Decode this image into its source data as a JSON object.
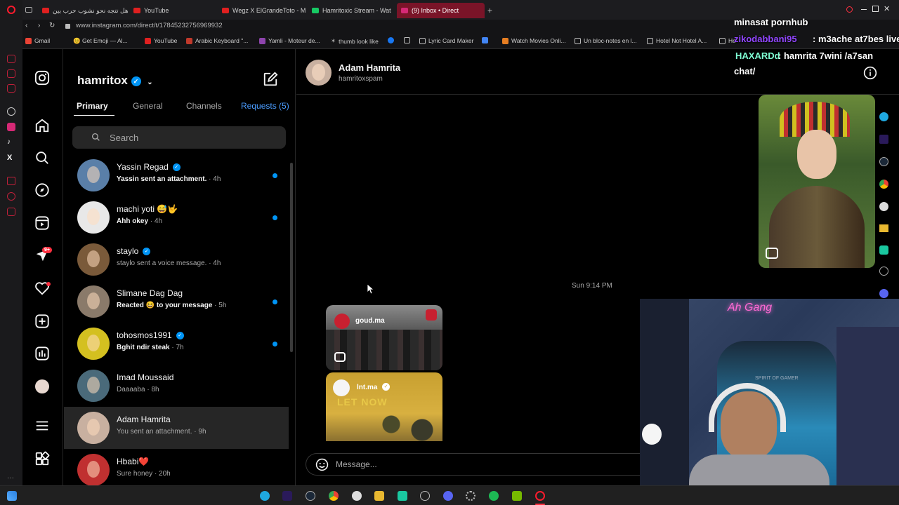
{
  "browser": {
    "tabs": [
      {
        "label": "هل تتجه نحو نشوب حرب بين",
        "color": "#e02020"
      },
      {
        "label": "YouTube",
        "color": "#e02020"
      },
      {
        "label": "Wegz X ElGrandeToto - M",
        "color": "#e02020"
      },
      {
        "label": "Hamritoxic Stream - Wat",
        "color": "#6441a5"
      },
      {
        "label": "(9) Inbox • Direct",
        "color": "#d62976",
        "active": true
      }
    ],
    "url": "www.instagram.com/direct/t/17845232756969932",
    "bookmarks": [
      "Gmail",
      "😊 Get Emoji — Al...",
      "YouTube",
      "Arabic Keyboard \"...",
      "Yamli - Moteur de...",
      "thumb look like",
      "",
      "Lyric Card Maker",
      "",
      "Watch Movies Onli...",
      "Un bloc-notes en l...",
      "Hotel Not Hotel A...",
      "Ho"
    ]
  },
  "nav": {
    "notifications_badge": "9+"
  },
  "inbox": {
    "username": "hamritox",
    "tabs": [
      {
        "label": "Primary",
        "active": true
      },
      {
        "label": "General"
      },
      {
        "label": "Channels"
      },
      {
        "label": "Requests (5)",
        "link": true
      }
    ],
    "search_placeholder": "Search",
    "threads": [
      {
        "name": "Yassin Regad",
        "verified": true,
        "message": "Yassin sent an attachment.",
        "time": "· 4h",
        "unread": true,
        "avatar": "#5a7fa8"
      },
      {
        "name": "machi yoti 😅🤟",
        "message": "Ahh okey",
        "time": "· 4h",
        "unread": true,
        "avatar": "#e8e8e8"
      },
      {
        "name": "staylo",
        "verified": true,
        "message": "staylo sent a voice message.",
        "time": "· 4h",
        "unread": false,
        "avatar": "#7a5a3a"
      },
      {
        "name": "Slimane Dag Dag",
        "message": "Reacted 😆 to your message",
        "time": "· 5h",
        "unread": true,
        "avatar": "#8a7a6a"
      },
      {
        "name": "tohosmos1991",
        "verified": true,
        "message": "Bghit ndir steak",
        "time": "· 7h",
        "unread": true,
        "avatar": "#d4c020"
      },
      {
        "name": "Imad Moussaid",
        "message": "Daaaaba",
        "time": "· 8h",
        "unread": false,
        "avatar": "#4a6a7a"
      },
      {
        "name": "Adam Hamrita",
        "message": "You sent an attachment.",
        "time": "· 9h",
        "unread": false,
        "selected": true,
        "avatar": "#c8b0a0"
      },
      {
        "name": "Hbabi❤️",
        "message": "Sure honey",
        "time": "· 20h",
        "unread": false,
        "avatar": "#c03030"
      }
    ]
  },
  "conversation": {
    "name": "Adam Hamrita",
    "handle": "hamritoxspam",
    "timestamp": "Sun 9:14 PM",
    "shared_posts": [
      {
        "account": "goud.ma"
      },
      {
        "account": "lnt.ma",
        "caption": "LET NOW"
      }
    ],
    "message_placeholder": "Message..."
  },
  "stream_chat": [
    {
      "text": "minasat pornhub",
      "color": "#ffffff"
    },
    {
      "text": "zikodabbani95",
      "color": "#9146ff"
    },
    {
      "text": ": m3ache at7bes live",
      "color": "#ffffff"
    },
    {
      "text": "HAXARDd",
      "color": "#7fffd4"
    },
    {
      "text": ": hamrita 7wini /a7san",
      "color": "#ffffff"
    },
    {
      "text": "chat/",
      "color": "#ffffff"
    }
  ],
  "webcam": {
    "sign": "Ah Gang",
    "chair_text": "SPIRIT OF GAMER"
  }
}
